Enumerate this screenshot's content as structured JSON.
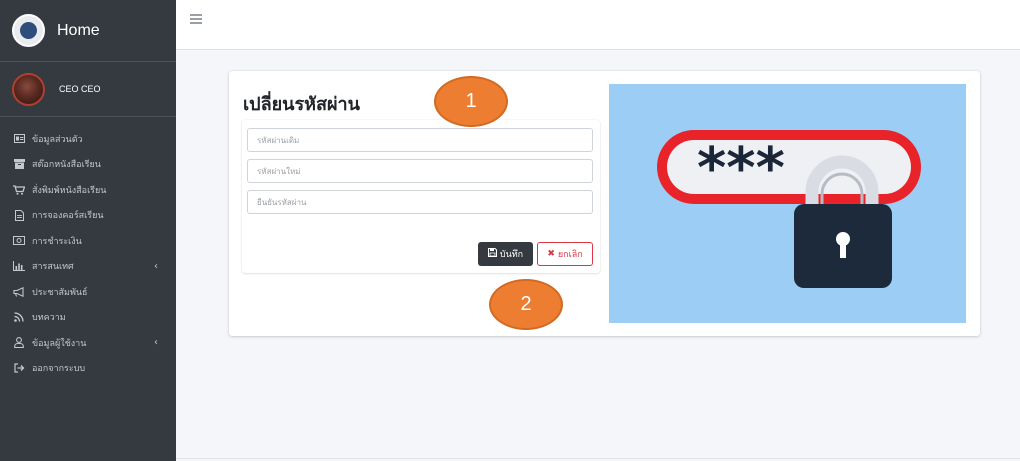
{
  "sidebar": {
    "brand_title": "Home",
    "user_name": "CEO CEO",
    "items": [
      {
        "label": "ข้อมูลส่วนตัว",
        "icon": "id-card-icon"
      },
      {
        "label": "สต๊อกหนังสือเรียน",
        "icon": "archive-icon"
      },
      {
        "label": "สั่งพิมพ์หนังสือเรียน",
        "icon": "cart-icon"
      },
      {
        "label": "การจองคอร์สเรียน",
        "icon": "file-icon"
      },
      {
        "label": "การชำระเงิน",
        "icon": "money-icon"
      },
      {
        "label": "สารสนเทศ",
        "icon": "chart-icon",
        "has_submenu": true
      },
      {
        "label": "ประชาสัมพันธ์",
        "icon": "bullhorn-icon"
      },
      {
        "label": "บทความ",
        "icon": "rss-icon"
      },
      {
        "label": "ข้อมูลผู้ใช้งาน",
        "icon": "user-icon",
        "has_submenu": true
      },
      {
        "label": "ออกจากระบบ",
        "icon": "sign-out-icon"
      }
    ]
  },
  "page": {
    "title": "เปลี่ยนรหัสผ่าน"
  },
  "form": {
    "old_password_placeholder": "รหัสผ่านเดิม",
    "new_password_placeholder": "รหัสผ่านใหม่",
    "confirm_password_placeholder": "ยืนยันรหัสผ่าน",
    "save_label": "บันทึก",
    "cancel_label": "ยกเลิก"
  },
  "illustration": {
    "masked_text": "***"
  },
  "callouts": {
    "first": "1",
    "second": "2"
  },
  "colors": {
    "sidebar_bg": "#343a40",
    "callout": "#ed7d31",
    "danger": "#dc3545",
    "illustration_bg": "#9ccdf5"
  }
}
